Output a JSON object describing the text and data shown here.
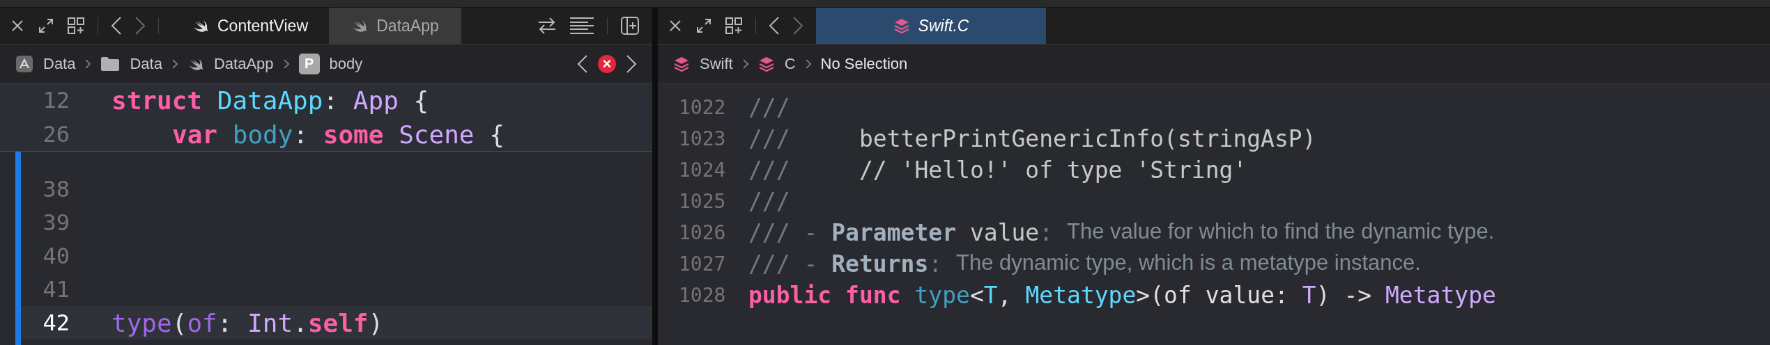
{
  "panes": [
    {
      "tabs": [
        {
          "label": "ContentView",
          "selected": false
        },
        {
          "label": "DataApp",
          "selected": true
        }
      ],
      "breadcrumb": [
        {
          "kind": "app",
          "label": "Data"
        },
        {
          "kind": "folder",
          "label": "Data"
        },
        {
          "kind": "swift",
          "label": "DataApp"
        },
        {
          "kind": "property",
          "badge": "P",
          "label": "body"
        }
      ],
      "error_badge": "×",
      "change_bar": true,
      "sticky_lines": [
        {
          "number": "12",
          "indented": false,
          "tokens": [
            {
              "kind": "kw",
              "text": "struct "
            },
            {
              "kind": "typedecl",
              "text": "DataApp"
            },
            {
              "kind": "plain",
              "text": ": "
            },
            {
              "kind": "type",
              "text": "App"
            },
            {
              "kind": "plain",
              "text": " {"
            }
          ]
        },
        {
          "number": "26",
          "indented": true,
          "tokens": [
            {
              "kind": "kw",
              "text": "var "
            },
            {
              "kind": "func",
              "text": "body"
            },
            {
              "kind": "plain",
              "text": ": "
            },
            {
              "kind": "kw",
              "text": "some "
            },
            {
              "kind": "type",
              "text": "Scene"
            },
            {
              "kind": "plain",
              "text": " {"
            }
          ]
        }
      ],
      "lines": [
        {
          "number": "38",
          "current": false
        },
        {
          "number": "39",
          "current": false
        },
        {
          "number": "40",
          "current": false
        },
        {
          "number": "41",
          "current": false
        },
        {
          "number": "42",
          "current": true,
          "tokens": [
            {
              "kind": "other",
              "text": "type"
            },
            {
              "kind": "plain",
              "text": "("
            },
            {
              "kind": "other",
              "text": "of"
            },
            {
              "kind": "plain",
              "text": ": "
            },
            {
              "kind": "type",
              "text": "Int"
            },
            {
              "kind": "plain",
              "text": "."
            },
            {
              "kind": "kw",
              "text": "self"
            },
            {
              "kind": "plain",
              "text": ")"
            }
          ]
        }
      ]
    },
    {
      "tabs": [
        {
          "label": "Swift.C",
          "selected": true
        }
      ],
      "breadcrumb": [
        {
          "kind": "module",
          "label": "Swift"
        },
        {
          "kind": "module",
          "label": "C"
        },
        {
          "kind": "none",
          "label": "No Selection"
        }
      ],
      "change_bar": false,
      "lines": [
        {
          "number": "1022",
          "current": false,
          "tokens": [
            {
              "kind": "comment",
              "text": "///"
            }
          ]
        },
        {
          "number": "1023",
          "current": false,
          "tokens": [
            {
              "kind": "comment",
              "text": "///"
            },
            {
              "kind": "docmono",
              "text": "     betterPrintGenericInfo(stringAsP)"
            }
          ]
        },
        {
          "number": "1024",
          "current": false,
          "tokens": [
            {
              "kind": "comment",
              "text": "///"
            },
            {
              "kind": "docmono",
              "text": "     // 'Hello!' of type 'String'"
            }
          ]
        },
        {
          "number": "1025",
          "current": false,
          "tokens": [
            {
              "kind": "comment",
              "text": "///"
            }
          ]
        },
        {
          "number": "1026",
          "current": false,
          "tokens": [
            {
              "kind": "comment",
              "text": "/// - "
            },
            {
              "kind": "docbold",
              "text": "Parameter"
            },
            {
              "kind": "docmono",
              "text": " value"
            },
            {
              "kind": "comment",
              "text": ": "
            },
            {
              "kind": "doctext",
              "text": "The value for which to find the dynamic type."
            }
          ]
        },
        {
          "number": "1027",
          "current": false,
          "tokens": [
            {
              "kind": "comment",
              "text": "/// - "
            },
            {
              "kind": "docbold",
              "text": "Returns"
            },
            {
              "kind": "comment",
              "text": ": "
            },
            {
              "kind": "doctext",
              "text": "The dynamic type, which is a metatype instance."
            }
          ]
        },
        {
          "number": "1028",
          "current": false,
          "tokens": [
            {
              "kind": "kw",
              "text": "public func "
            },
            {
              "kind": "func",
              "text": "type"
            },
            {
              "kind": "plain",
              "text": "<"
            },
            {
              "kind": "typedecl",
              "text": "T"
            },
            {
              "kind": "plain",
              "text": ", "
            },
            {
              "kind": "typedecl",
              "text": "Metatype"
            },
            {
              "kind": "plain",
              "text": ">(of value: "
            },
            {
              "kind": "type",
              "text": "T"
            },
            {
              "kind": "plain",
              "text": ") -> "
            },
            {
              "kind": "type",
              "text": "Metatype"
            }
          ]
        }
      ]
    }
  ]
}
